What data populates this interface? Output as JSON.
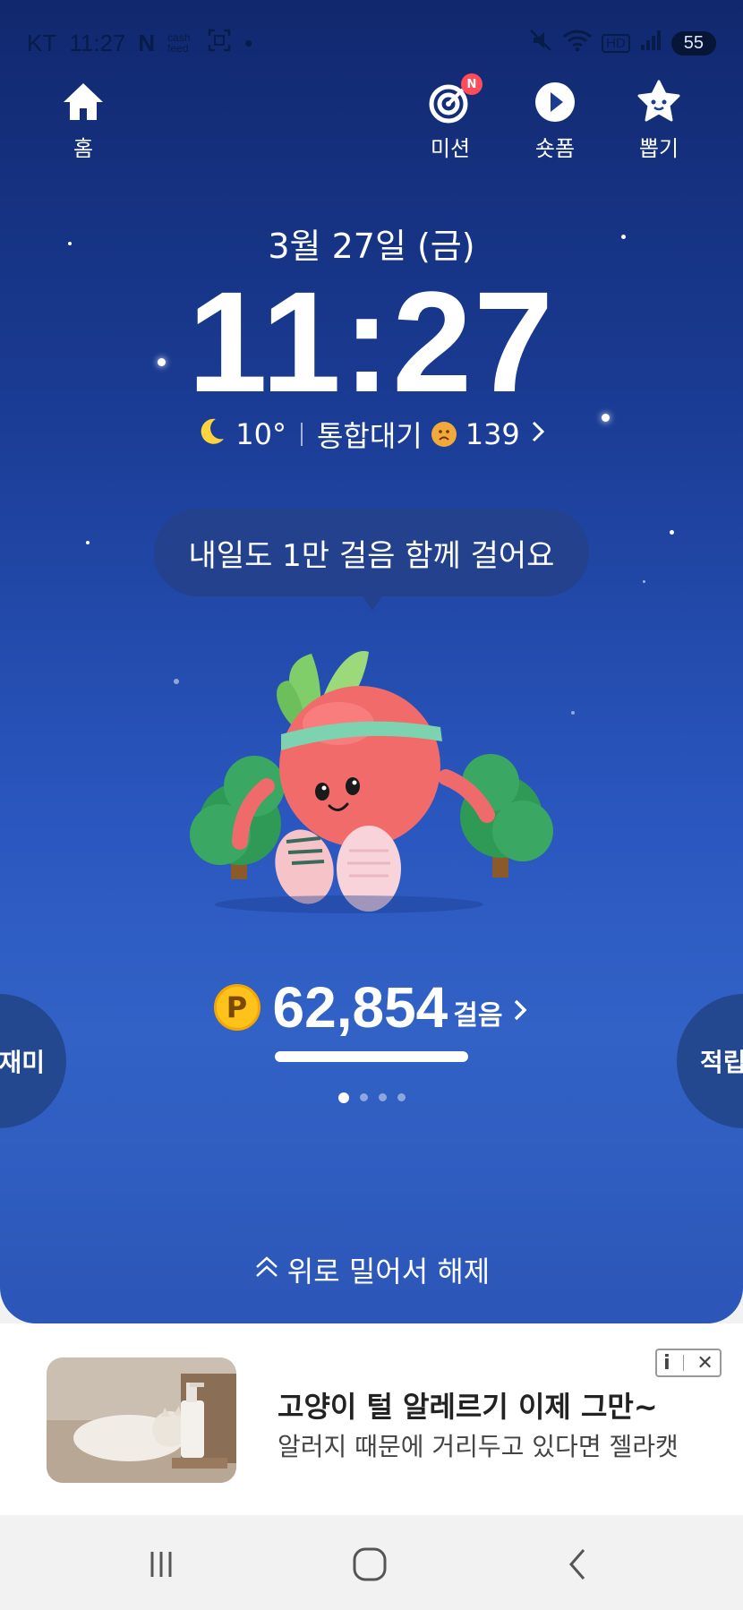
{
  "status_bar": {
    "carrier": "KT",
    "time": "11:27",
    "app_icons": [
      "N",
      "cash feed",
      "screenshot-icon",
      "•"
    ],
    "network_label": "HD",
    "battery": "55"
  },
  "top_nav": {
    "home_label": "홈",
    "mission_label": "미션",
    "mission_badge": "N",
    "shortform_label": "숏폼",
    "draw_label": "뽑기"
  },
  "lockscreen": {
    "date": "3월 27일 (금)",
    "time": "11:27",
    "temperature": "10°",
    "air_quality_label": "통합대기",
    "air_quality_value": "139",
    "bubble_text": "내일도 1만 걸음 함께 걸어요"
  },
  "steps": {
    "coin_label": "P",
    "count": "62,854",
    "unit": "걸음",
    "progress_fraction": 1.0
  },
  "pager": {
    "total": 4,
    "active": 0
  },
  "side_buttons": {
    "left": "재미",
    "right": "적립"
  },
  "unlock_text": "위로 밀어서 해제",
  "ad": {
    "title": "고양이 털 알레르기 이제 그만~",
    "description": "알러지 때문에 거리두고 있다면 젤라캣",
    "info_label": "i",
    "close_label": "✕"
  },
  "colors": {
    "bg_top": "#11286e",
    "bg_bottom": "#3262c6",
    "coin": "#ffc21a",
    "badge": "#ff4b5a"
  }
}
